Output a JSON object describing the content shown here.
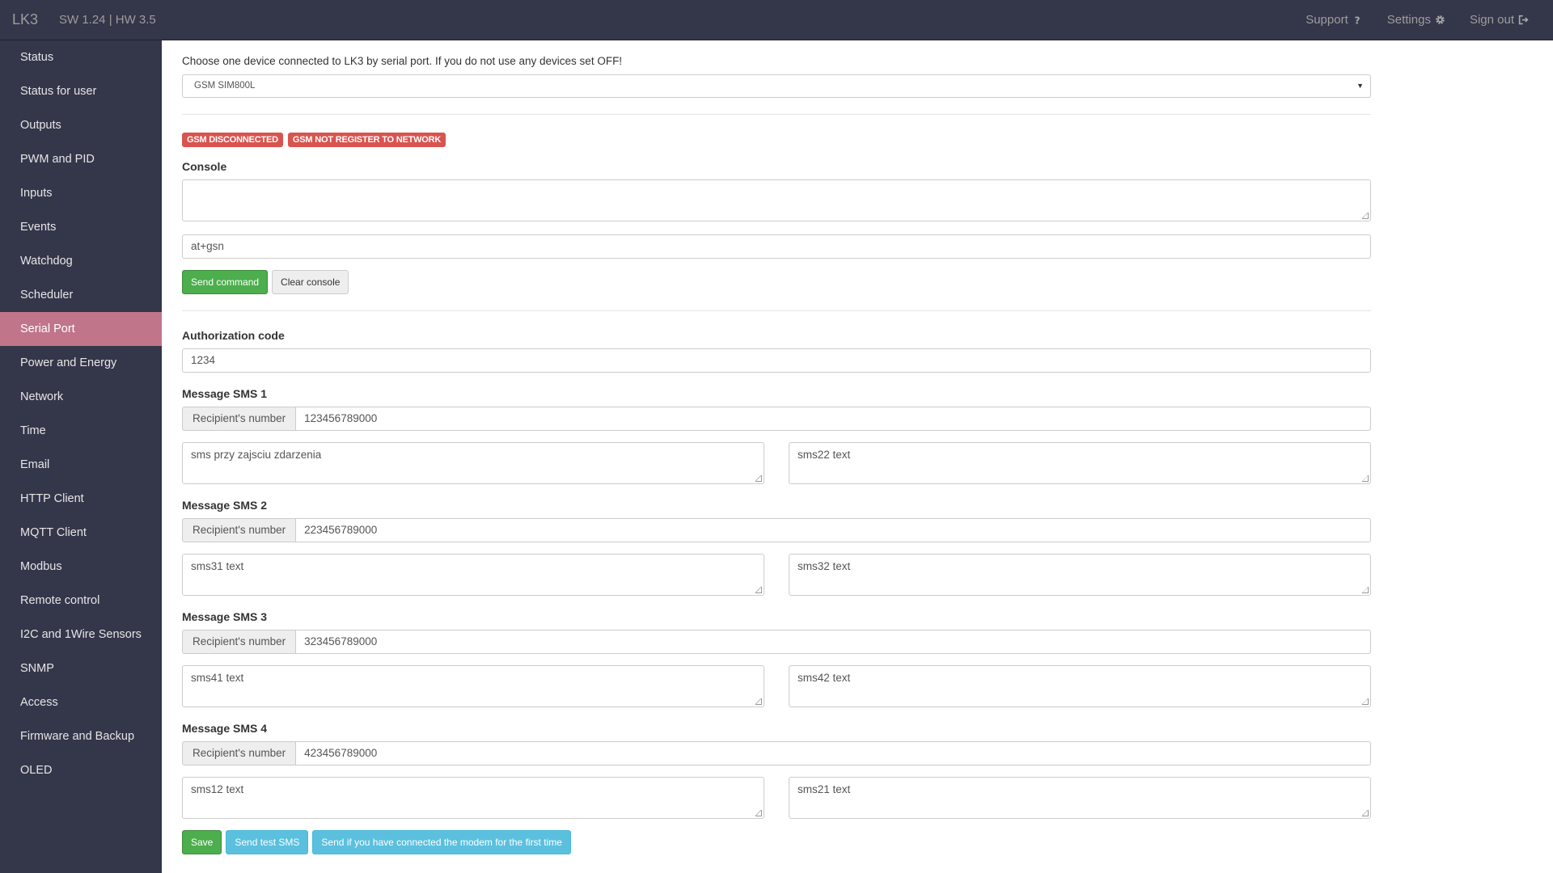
{
  "header": {
    "brand": "LK3",
    "version": "SW 1.24 | HW 3.5",
    "nav": [
      {
        "label": "Support",
        "icon": "question-icon"
      },
      {
        "label": "Settings",
        "icon": "gear-icon"
      },
      {
        "label": "Sign out",
        "icon": "sign-out-icon"
      }
    ]
  },
  "sidebar": {
    "items": [
      {
        "label": "Status"
      },
      {
        "label": "Status for user"
      },
      {
        "label": "Outputs"
      },
      {
        "label": "PWM and PID"
      },
      {
        "label": "Inputs"
      },
      {
        "label": "Events"
      },
      {
        "label": "Watchdog"
      },
      {
        "label": "Scheduler"
      },
      {
        "label": "Serial Port",
        "active": true
      },
      {
        "label": "Power and Energy"
      },
      {
        "label": "Network"
      },
      {
        "label": "Time"
      },
      {
        "label": "Email"
      },
      {
        "label": "HTTP Client"
      },
      {
        "label": "MQTT Client"
      },
      {
        "label": "Modbus"
      },
      {
        "label": "Remote control"
      },
      {
        "label": "I2C and 1Wire Sensors"
      },
      {
        "label": "SNMP"
      },
      {
        "label": "Access"
      },
      {
        "label": "Firmware and Backup"
      },
      {
        "label": "OLED"
      }
    ]
  },
  "main": {
    "intro": "Choose one device connected to LK3 by serial port. If you do not use any devices set OFF!",
    "device_select": "GSM SIM800L",
    "badges": [
      "GSM DISCONNECTED",
      "GSM NOT REGISTER TO NETWORK"
    ],
    "console": {
      "label": "Console",
      "output": "",
      "command": "at+gsn",
      "send_label": "Send command",
      "clear_label": "Clear console"
    },
    "auth": {
      "label": "Authorization code",
      "value": "1234"
    },
    "recipient_label": "Recipient's number",
    "sms": [
      {
        "title": "Message SMS 1",
        "number": "123456789000",
        "text_a": "sms przy zajsciu zdarzenia",
        "text_b": "sms22 text"
      },
      {
        "title": "Message SMS 2",
        "number": "223456789000",
        "text_a": "sms31 text",
        "text_b": "sms32 text"
      },
      {
        "title": "Message SMS 3",
        "number": "323456789000",
        "text_a": "sms41 text",
        "text_b": "sms42 text"
      },
      {
        "title": "Message SMS 4",
        "number": "423456789000",
        "text_a": "sms12 text",
        "text_b": "sms21 text"
      }
    ],
    "buttons": {
      "save": "Save",
      "test_sms": "Send test SMS",
      "first_time": "Send if you have connected the modem for the first time"
    }
  }
}
